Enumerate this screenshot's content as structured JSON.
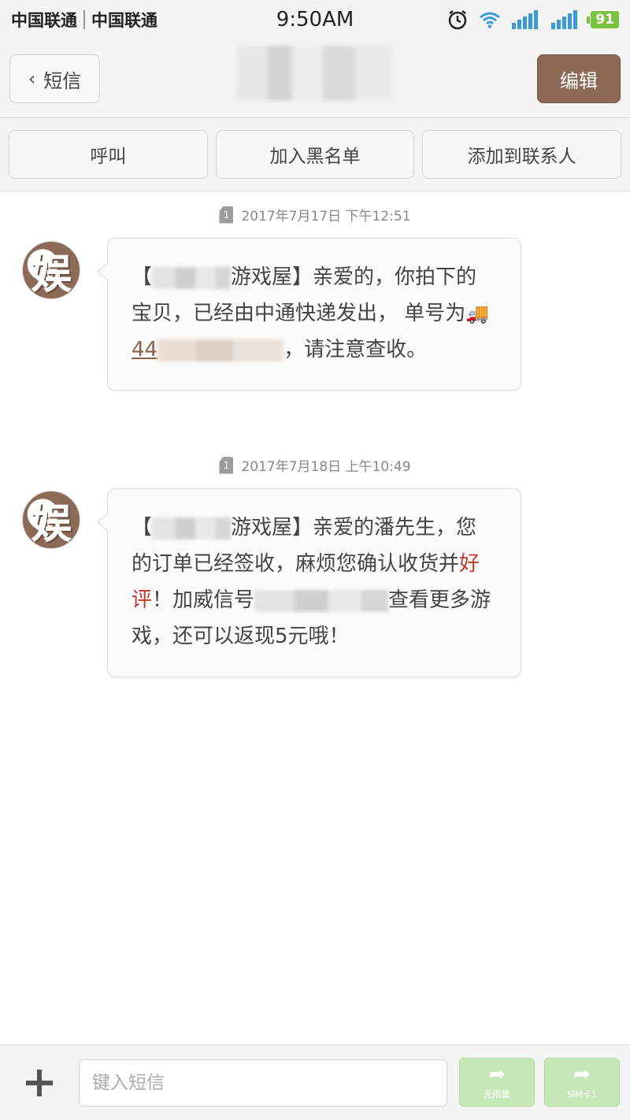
{
  "status_bar": {
    "carrier1": "中国联通",
    "carrier2": "中国联通",
    "time": "9:50AM",
    "battery": "91"
  },
  "header": {
    "back_label": "短信",
    "edit_label": "编辑"
  },
  "actions": {
    "call": "呼叫",
    "blacklist": "加入黑名单",
    "add_contact": "添加到联系人"
  },
  "messages": [
    {
      "timestamp": "2017年7月17日 下午12:51",
      "sim": "1",
      "part1": "【",
      "part2": "游戏屋】亲爱的，你拍下的宝贝，已经由中通快递发出， 单号为",
      "tracking_prefix": "44",
      "part3": "，请注意查收。"
    },
    {
      "timestamp": "2017年7月18日 上午10:49",
      "sim": "1",
      "part1": "【",
      "part2": "游戏屋】亲爱的潘先生，您的订单已经签收，麻烦您确认收货并",
      "highlight": "好评",
      "part3": "！加威信号",
      "part4": "查看更多游戏，还可以返现5元哦！"
    }
  ],
  "bottom_bar": {
    "input_placeholder": "键入短信",
    "send1_label": "无限量",
    "send2_label": "SIM卡1"
  }
}
